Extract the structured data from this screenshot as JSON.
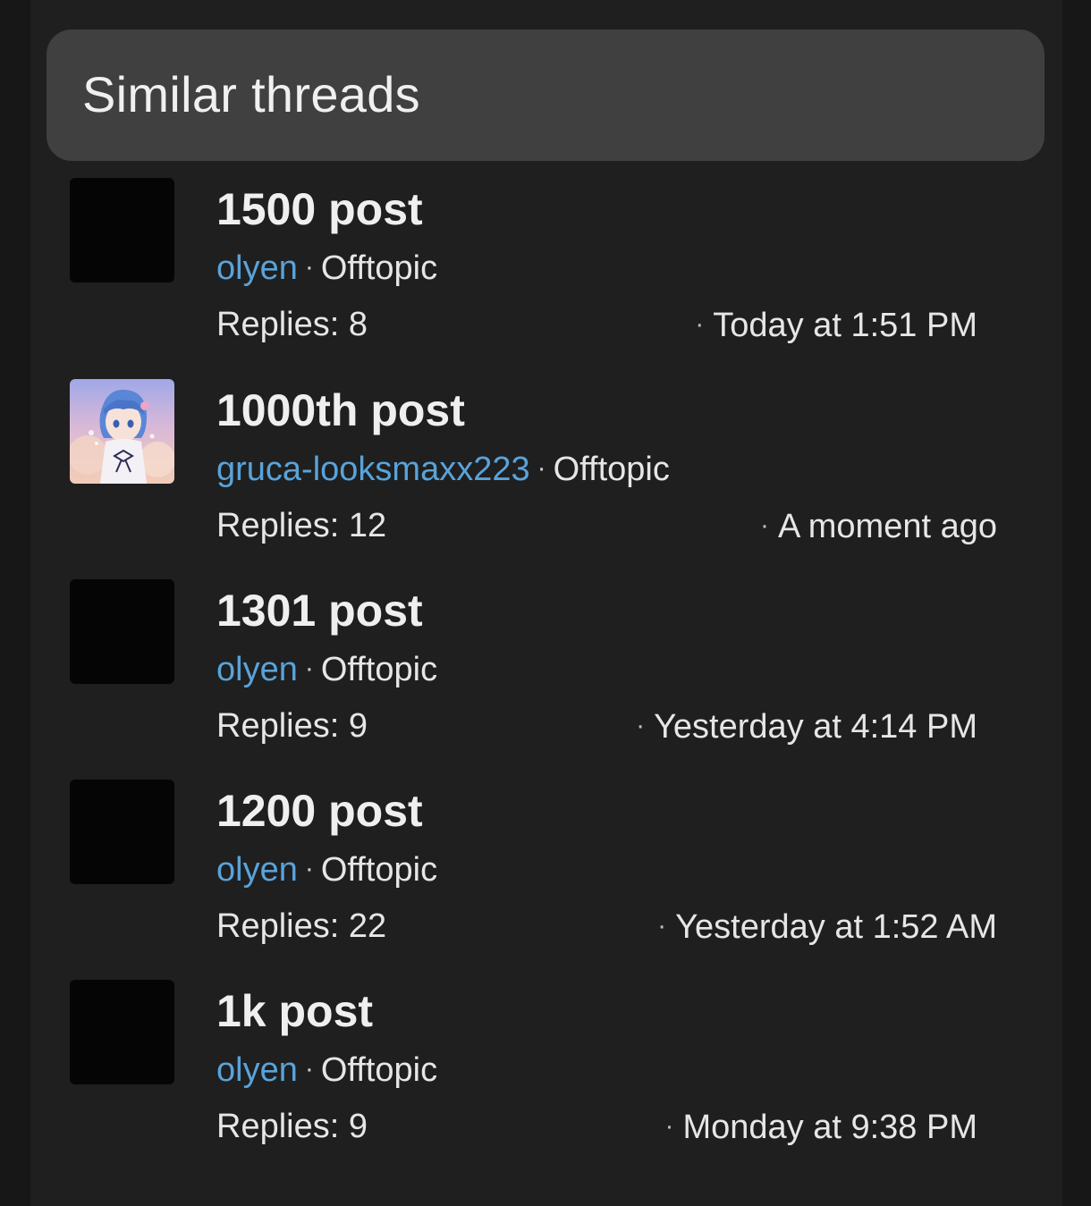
{
  "section": {
    "title": "Similar threads"
  },
  "threads": [
    {
      "title": "1500 post",
      "author": "olyen",
      "forum": "Offtopic",
      "replies": "Replies: 8",
      "time": "Today at 1:51 PM",
      "avatar": "blacked-out-avatar"
    },
    {
      "title": "1000th post",
      "author": "gruca-looksmaxx223",
      "forum": "Offtopic",
      "replies": "Replies: 12",
      "time": "A moment ago",
      "avatar": "anime-character-avatar"
    },
    {
      "title": "1301 post",
      "author": "olyen",
      "forum": "Offtopic",
      "replies": "Replies: 9",
      "time": "Yesterday at 4:14 PM",
      "avatar": "blacked-out-avatar"
    },
    {
      "title": "1200 post",
      "author": "olyen",
      "forum": "Offtopic",
      "replies": "Replies: 22",
      "time": "Yesterday at 1:52 AM",
      "avatar": "blacked-out-avatar"
    },
    {
      "title": "1k post",
      "author": "olyen",
      "forum": "Offtopic",
      "replies": "Replies: 9",
      "time": "Monday at 9:38 PM",
      "avatar": "blacked-out-avatar"
    }
  ]
}
